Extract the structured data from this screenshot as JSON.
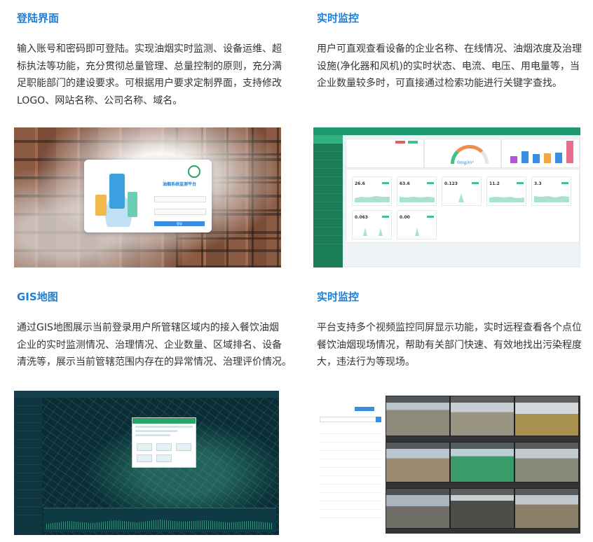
{
  "sections": [
    {
      "title": "登陆界面",
      "lines": [
        "输入账号和密码即可登陆。实现油烟实时监测、设备运维、超",
        "标执法等功能，充分贯彻总量管理、总量控制的原则，充分满",
        "足职能部门的建设要求。可根据用户要求定制界面，支持修改",
        "LOGO、网站名称、公司名称、域名。"
      ]
    },
    {
      "title": "实时监控",
      "lines": [
        "用户可直观查看设备的企业名称、在线情况、油烟浓度及治理",
        "设施(净化器和风机)的实时状态、电流、电压、用电量等，当",
        "企业数量较多时，可直接通过检索功能进行关键字查找。"
      ]
    },
    {
      "title": "GIS地图",
      "lines": [
        "通过GIS地图展示当前登录用户所管辖区域内的接入餐饮油烟",
        "企业的实时监测情况、治理情况、企业数量、区域排名、设备",
        "清洗等，展示当前管辖范围内存在的异常情况、治理评价情况。"
      ]
    },
    {
      "title": "实时监控",
      "lines": [
        "平台支持多个视频监控同屏显示功能，实时远程查看各个点位",
        "餐饮油烟现场情况，帮助有关部门快速、有效地找出污染程度",
        "大，违法行为等现场。"
      ]
    }
  ],
  "login_shot": {
    "system_title": "油烟系统监测平台",
    "button": "登录"
  },
  "dashboard_shot": {
    "gauge_value": "0mg/m³",
    "readings": [
      "26.6",
      "63.6",
      "0.123",
      "11.2",
      "3.3",
      "0.063",
      "0.00"
    ]
  },
  "colors": {
    "title_blue": "#1e7fd8",
    "brand_green": "#1f9a6c"
  }
}
